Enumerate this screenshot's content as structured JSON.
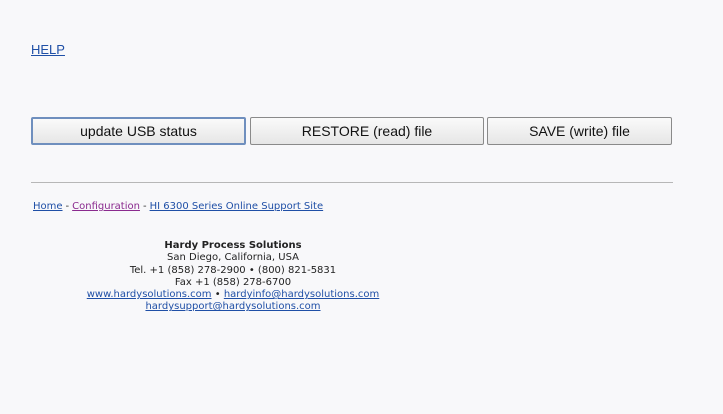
{
  "help": {
    "label": "HELP"
  },
  "buttons": {
    "update_usb": "update USB status",
    "restore": "RESTORE (read) file",
    "save": "SAVE (write) file"
  },
  "footer_links": {
    "home": "Home",
    "separator": "-",
    "configuration": "Configuration",
    "support_site": "HI 6300 Series Online Support Site"
  },
  "contact": {
    "company": "Hardy Process Solutions",
    "location": "San Diego, California, USA",
    "tel": "Tel. +1 (858) 278-2900 • (800) 821-5831",
    "fax": "Fax +1 (858) 278-6700",
    "website": "www.hardysolutions.com",
    "bullet": "•",
    "info_email": "hardyinfo@hardysolutions.com",
    "support_email": "hardysupport@hardysolutions.com"
  },
  "colors": {
    "link": "#1f4fa6",
    "visited_link": "#8a2a8e",
    "background": "#f8f8fa"
  }
}
